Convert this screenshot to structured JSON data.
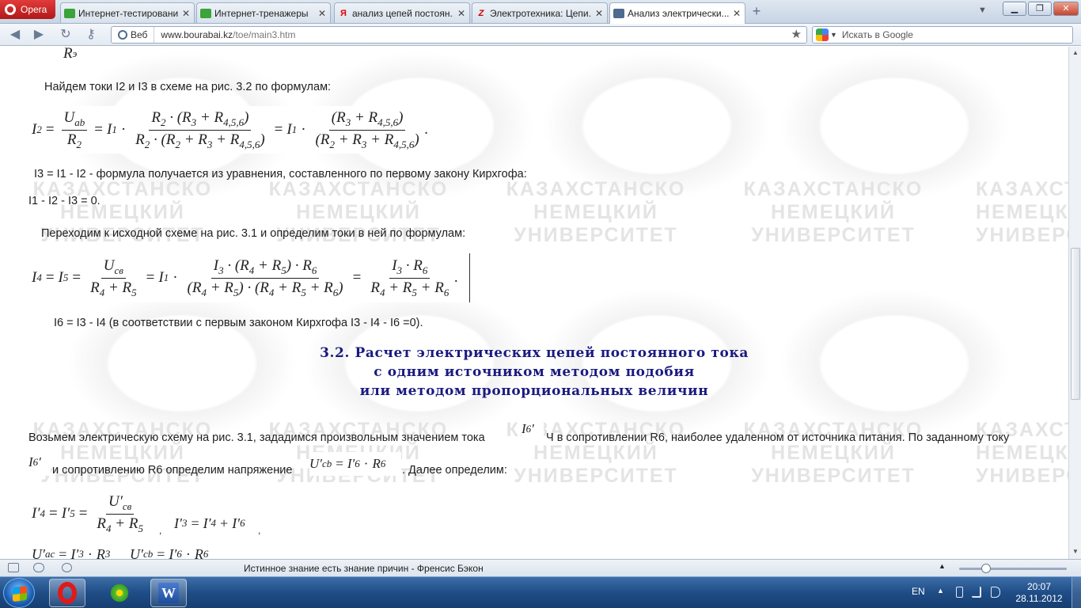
{
  "browser": {
    "menu_label": "Opera",
    "tabs": [
      {
        "label": "Интернет-тестирование",
        "icon": "green-tab-icon"
      },
      {
        "label": "Интернет-тренажеры",
        "icon": "green-tab-icon"
      },
      {
        "label": "анализ цепей постоян...",
        "icon": "yandex-icon"
      },
      {
        "label": "Электротехника: Цепи...",
        "icon": "z-site-icon"
      },
      {
        "label": "Анализ электрически...",
        "icon": "page-icon"
      }
    ],
    "site_badge": "Веб",
    "url_domain": "www.bourabai.kz",
    "url_path": "/toe/main3.htm",
    "search_placeholder": "Искать в Google"
  },
  "page": {
    "watermark_lines": [
      "КАЗАХСТАНСКО",
      "НЕМЕЦКИЙ",
      "УНИВЕРСИТЕТ"
    ],
    "p_find_i2_i3": "Найдем токи I2 и I3 в схеме на рис. 3.2 по формулам:",
    "p_i3": "I3 = I1 - I2 - формула получается из уравнения, составленного по первому закону Кирхгофа:",
    "p_kirchhoff": "I1 - I2 - I3 = 0.",
    "p_goto_source": "Переходим к исходной схеме на рис. 3.1 и определим токи в ней по формулам:",
    "p_i6": "I6 = I3 - I4 (в соответствии с первым законом Кирхгофа I3 - I4 - I6 =0).",
    "heading_lines": [
      "3.2. Расчет электрических цепей постоянного тока",
      "с одним источником методом подобия",
      "или методом пропорциональных величин"
    ],
    "p_take_scheme_a": "Возьмем электрическую схему на рис. 3.1, зададимся произвольным значением тока",
    "p_take_scheme_b": "Ч в сопротивлении R6, наиболее удаленном от источника питания. По заданному току",
    "p_resistance_a": "и сопротивлению R6 определим напряжение",
    "p_resistance_b": ". Далее определим:"
  },
  "status": {
    "text": "Истинное знание есть знание причин - Френсис Бэкон",
    "zoom_level": 0.25
  },
  "taskbar": {
    "lang": "EN",
    "time": "20:07",
    "date": "28.11.2012"
  }
}
